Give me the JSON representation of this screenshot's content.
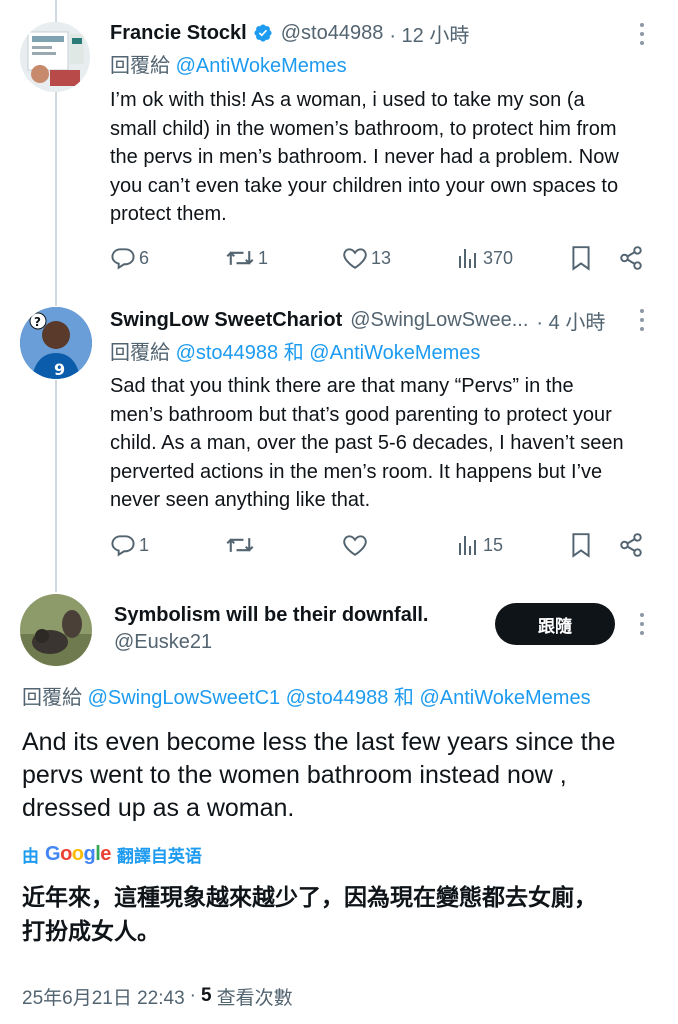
{
  "reply1": {
    "name": "Francie Stockl",
    "handle": "@sto44988",
    "time": "· 12 小時",
    "reply_prefix": "回覆給",
    "reply_targets": "@AntiWokeMemes",
    "body": [
      "I’m ok with this! As a woman, i used to take my son (a",
      "small child) in the women’s bathroom, to protect him from",
      "the pervs in men’s bathroom. I never had a problem. Now",
      "you can’t even take your children into your own spaces to",
      "protect them."
    ],
    "stats": {
      "replies": "6",
      "reposts": "1",
      "likes": "13",
      "views": "370"
    }
  },
  "reply2": {
    "name": "SwingLow SweetChariot",
    "handle": "@SwingLowSwee...",
    "time": "· 4 小時",
    "reply_prefix": "回覆給",
    "reply_target_1": "@sto44988",
    "reply_and": "和",
    "reply_target_2": "@AntiWokeMemes",
    "body": [
      "Sad that you think there are that many “Pervs” in the",
      "men’s bathroom but that’s good parenting to protect your",
      "child.  As a man, over the past 5-6 decades, I haven’t seen",
      "perverted actions in the men’s room.  It happens but I’ve",
      "never seen anything like that."
    ],
    "stats": {
      "replies": "1",
      "reposts": "",
      "likes": "",
      "views": "15"
    }
  },
  "focus": {
    "name": "Symbolism will be their downfall.",
    "handle": "@Euske21",
    "follow_label": "跟隨",
    "reply_prefix": "回覆給",
    "reply_target_1": "@SwingLowSweetC1",
    "reply_target_2": "@sto44988",
    "reply_and": "和",
    "reply_target_3": "@AntiWokeMemes",
    "body": [
      "And its even become less the last few years since the",
      "pervs went to the women bathroom instead now ,",
      "dressed up as a woman."
    ],
    "translate_by": "由",
    "translate_brand": "Google",
    "translate_label": "翻譯自英语",
    "translation": [
      "近年來，這種現象越來越少了，因為現在變態都去女廁，",
      "打扮成女人。"
    ],
    "date": "25年6月21日 22:43",
    "views_sep": "·",
    "views_count": "5",
    "views_label": "查看次數"
  },
  "colors": {
    "link": "#1d9bf0",
    "muted": "#536471",
    "verified": "#1d9bf0",
    "button_bg": "#0f1419"
  }
}
